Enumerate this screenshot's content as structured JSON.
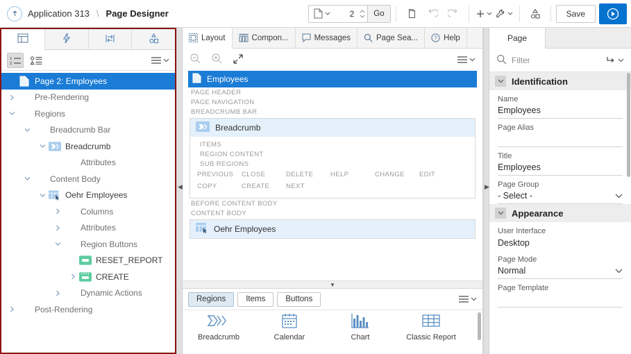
{
  "topbar": {
    "home_icon": "up-arrow-circle-icon",
    "app_label": "Application 313",
    "separator": "\\",
    "title": "Page Designer",
    "page_icon": "page-icon",
    "page_number": "2",
    "go_label": "Go",
    "copy_icon": "copy-page-icon",
    "undo_icon": "undo-icon",
    "redo_icon": "redo-icon",
    "create_icon": "plus-icon",
    "utilities_icon": "wrench-icon",
    "shared_icon": "shared-components-icon",
    "save_label": "Save",
    "run_icon": "run-play-icon"
  },
  "left_panel": {
    "tabs": [
      {
        "name": "rendering-tab",
        "icon": "layout-grid-icon"
      },
      {
        "name": "dynamic-actions-tab",
        "icon": "lightning-bolt-icon"
      },
      {
        "name": "processing-tab",
        "icon": "process-arrows-icon"
      },
      {
        "name": "shared-components-tab",
        "icon": "shapes-icon"
      }
    ],
    "toolbar": {
      "numbered_list_icon": "numbered-list-icon",
      "grouped_list_icon": "grouped-list-icon",
      "menu_icon": "hamburger-menu-icon"
    },
    "tree": [
      {
        "indent": 0,
        "twisty": "",
        "icon": "page-icon",
        "label": "Page 2: Employees",
        "selected": true
      },
      {
        "indent": 0,
        "twisty": ">",
        "icon": "",
        "label": "Pre-Rendering"
      },
      {
        "indent": 0,
        "twisty": "v",
        "icon": "",
        "label": "Regions"
      },
      {
        "indent": 1,
        "twisty": "v",
        "icon": "",
        "label": "Breadcrumb Bar"
      },
      {
        "indent": 2,
        "twisty": "v",
        "icon": "breadcrumb-icon",
        "label": "Breadcrumb",
        "dark": true
      },
      {
        "indent": 3,
        "twisty": "",
        "icon": "",
        "label": "Attributes"
      },
      {
        "indent": 1,
        "twisty": "v",
        "icon": "",
        "label": "Content Body"
      },
      {
        "indent": 2,
        "twisty": "v",
        "icon": "report-icon",
        "label": "Oehr Employees",
        "dark": true
      },
      {
        "indent": 3,
        "twisty": ">",
        "icon": "",
        "label": "Columns"
      },
      {
        "indent": 3,
        "twisty": ">",
        "icon": "",
        "label": "Attributes"
      },
      {
        "indent": 3,
        "twisty": "v",
        "icon": "",
        "label": "Region Buttons"
      },
      {
        "indent": 4,
        "twisty": "",
        "icon": "button-icon",
        "label": "RESET_REPORT",
        "dark": true
      },
      {
        "indent": 4,
        "twisty": ">",
        "icon": "button-hot-icon",
        "label": "CREATE",
        "dark": true
      },
      {
        "indent": 3,
        "twisty": ">",
        "icon": "",
        "label": "Dynamic Actions"
      },
      {
        "indent": 0,
        "twisty": ">",
        "icon": "",
        "label": "Post-Rendering"
      }
    ]
  },
  "center_panel": {
    "tabs": [
      {
        "label": "Layout",
        "icon": "layout-icon",
        "active": true
      },
      {
        "label": "Compon...",
        "icon": "component-view-icon",
        "active": false
      },
      {
        "label": "Messages",
        "icon": "message-icon",
        "active": false
      },
      {
        "label": "Page Sea...",
        "icon": "search-icon",
        "active": false
      },
      {
        "label": "Help",
        "icon": "help-icon",
        "active": false
      }
    ],
    "toolbar": {
      "zoom_out_icon": "zoom-out-icon",
      "zoom_in_icon": "zoom-in-icon",
      "expand_icon": "expand-arrows-icon",
      "menu_icon": "hamburger-menu-icon"
    },
    "page_header_label": "Employees",
    "page_header_icon": "page-icon",
    "slots_top": [
      "PAGE HEADER",
      "PAGE NAVIGATION",
      "BREADCRUMB BAR"
    ],
    "breadcrumb_region": {
      "icon": "breadcrumb-icon",
      "label": "Breadcrumb",
      "slots": [
        "ITEMS",
        "REGION CONTENT",
        "SUB REGIONS"
      ],
      "buttons_row1": [
        "PREVIOUS",
        "CLOSE",
        "DELETE",
        "HELP",
        "CHANGE",
        "EDIT"
      ],
      "buttons_row2": [
        "COPY",
        "CREATE",
        "NEXT"
      ]
    },
    "slots_mid": [
      "BEFORE CONTENT BODY",
      "CONTENT BODY"
    ],
    "content_region": {
      "icon": "report-icon",
      "label": "Oehr Employees"
    }
  },
  "gallery": {
    "tabs": [
      {
        "label": "Regions",
        "active": true
      },
      {
        "label": "Items",
        "active": false
      },
      {
        "label": "Buttons",
        "active": false
      }
    ],
    "menu_icon": "hamburger-menu-icon",
    "items": [
      {
        "label": "Breadcrumb",
        "icon": "breadcrumb-gallery-icon"
      },
      {
        "label": "Calendar",
        "icon": "calendar-icon"
      },
      {
        "label": "Chart",
        "icon": "chart-bars-icon"
      },
      {
        "label": "Classic Report",
        "icon": "table-grid-icon"
      }
    ]
  },
  "right_panel": {
    "tab_label": "Page",
    "filter": {
      "icon": "search-icon",
      "placeholder": "Filter",
      "reset_icon": "go-to-icon",
      "menu_icon": "chevron-down-icon"
    },
    "sections": [
      {
        "title": "Identification",
        "collapse_icon": "chevron-down-icon",
        "fields": [
          {
            "label": "Name",
            "value": "Employees",
            "type": "text"
          },
          {
            "label": "Page Alias",
            "value": "",
            "type": "text"
          },
          {
            "label": "Title",
            "value": "Employees",
            "type": "text"
          },
          {
            "label": "Page Group",
            "value": "- Select -",
            "type": "select"
          }
        ]
      },
      {
        "title": "Appearance",
        "collapse_icon": "chevron-down-icon",
        "fields": [
          {
            "label": "User Interface",
            "value": "Desktop",
            "type": "readonly"
          },
          {
            "label": "Page Mode",
            "value": "Normal",
            "type": "select"
          },
          {
            "label": "Page Template",
            "value": "",
            "type": "text"
          }
        ]
      }
    ]
  },
  "colors": {
    "accent_blue": "#0572ce",
    "selection_blue": "#1b7cd6",
    "highlight_border": "#8a1414",
    "region_light_blue": "#e4f0fb"
  }
}
